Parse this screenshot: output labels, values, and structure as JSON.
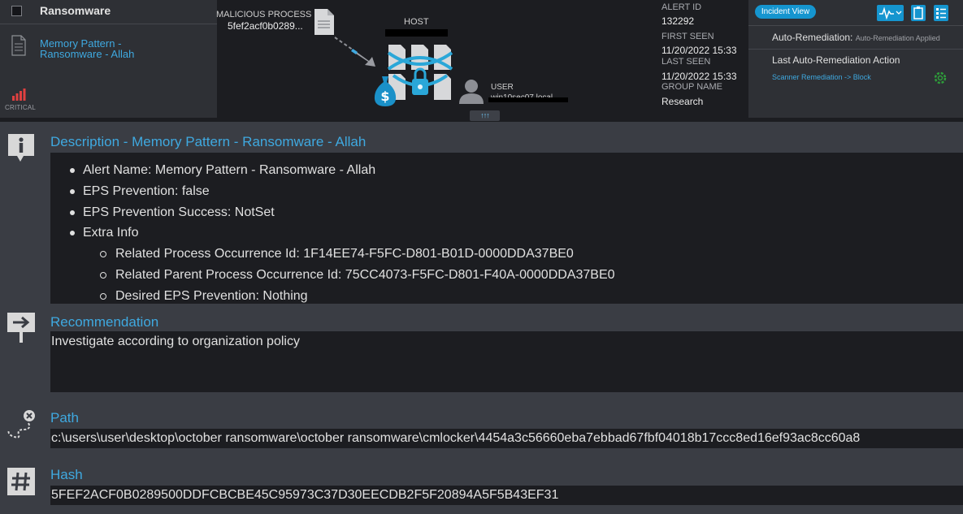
{
  "header": {
    "alert_title": "Ransomware",
    "rule_name": "Memory Pattern - Ransomware - Allah",
    "severity": "CRITICAL",
    "process_label": "MALICIOUS PROCESS",
    "process_name": "5fef2acf0b0289...",
    "host_label": "HOST",
    "user_label": "USER",
    "user_name": "win10sec07.local",
    "expand_label": "↑↑↑"
  },
  "meta": {
    "alert_id_label": "ALERT ID",
    "alert_id": "132292",
    "first_seen_label": "FIRST SEEN",
    "first_seen": "11/20/2022 15:33",
    "last_seen_label": "LAST SEEN",
    "last_seen": "11/20/2022 15:33",
    "group_label": "GROUP NAME",
    "group": "Research"
  },
  "right_panel": {
    "incident_view": "Incident View",
    "auto_remediation_label": "Auto-Remediation:",
    "auto_remediation_value": "Auto-Remediation Applied",
    "last_action_label": "Last Auto-Remediation Action",
    "last_action_value": "Scanner Remediation -> Block"
  },
  "description": {
    "title": "Description - Memory Pattern - Ransomware - Allah",
    "items": [
      "Alert Name: Memory Pattern - Ransomware - Allah",
      "EPS Prevention: false",
      "EPS Prevention Success: NotSet",
      "Extra Info"
    ],
    "extra_info": [
      "Related Process Occurrence Id: 1F14EE74-F5FC-D801-B01D-0000DDA37BE0",
      "Related Parent Process Occurrence Id: 75CC4073-F5FC-D801-F40A-0000DDA37BE0",
      "Desired EPS Prevention: Nothing"
    ]
  },
  "recommendation": {
    "title": "Recommendation",
    "text": "Investigate according to organization policy"
  },
  "path": {
    "title": "Path",
    "value": "c:\\users\\user\\desktop\\october ransomware\\october ransomware\\cmlocker\\4454a3c56660eba7ebbad67fbf04018b17ccc8ed16ef93ac8cc60a8"
  },
  "hash": {
    "title": "Hash",
    "value": "5FEF2ACF0B0289500DDFCBCBE45C95973C37D30EECDB2F5F20894A5F5B43EF31"
  },
  "icons": {
    "info": "info-icon",
    "recommendation": "signpost-arrow-icon",
    "path": "path-route-icon",
    "hash": "hash-icon"
  },
  "colors": {
    "accent": "#3fa9e0",
    "button": "#1595cf",
    "severity": "#e04040",
    "ok": "#2e9e3a"
  }
}
